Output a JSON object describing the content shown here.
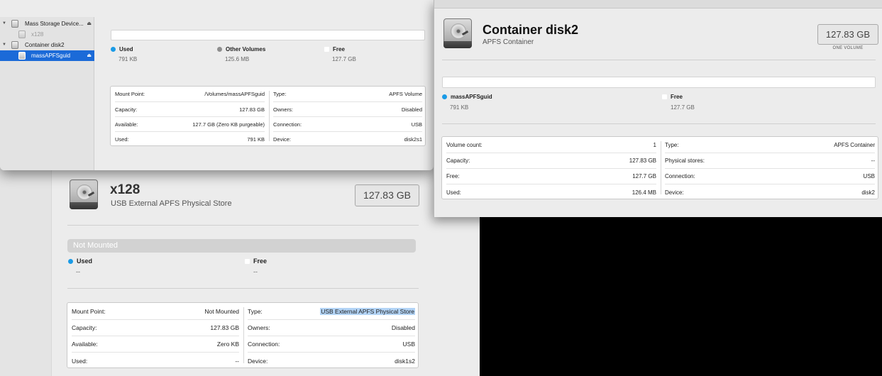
{
  "colors": {
    "used": "#1a9be6",
    "other": "#8e8e8e",
    "free": "#ffffff",
    "selection": "#1b6ad8"
  },
  "sidebar": {
    "items": [
      {
        "label": "Mass Storage Device...",
        "icon": "external-disk-icon",
        "eject": "⏏"
      },
      {
        "label": "x128",
        "icon": "disk-icon"
      },
      {
        "label": "Container disk2",
        "icon": "container-icon"
      },
      {
        "label": "massAPFSguid",
        "icon": "volume-icon",
        "eject": "⏏"
      }
    ]
  },
  "volume_window": {
    "legend": [
      {
        "label": "Used",
        "value": "791 KB"
      },
      {
        "label": "Other Volumes",
        "value": "125.6 MB"
      },
      {
        "label": "Free",
        "value": "127.7 GB"
      }
    ],
    "info_left": [
      {
        "key": "Mount Point:",
        "value": "/Volumes/massAPFSguid"
      },
      {
        "key": "Capacity:",
        "value": "127.83 GB"
      },
      {
        "key": "Available:",
        "value": "127.7 GB (Zero KB purgeable)"
      },
      {
        "key": "Used:",
        "value": "791 KB"
      }
    ],
    "info_right": [
      {
        "key": "Type:",
        "value": "APFS Volume"
      },
      {
        "key": "Owners:",
        "value": "Disabled"
      },
      {
        "key": "Connection:",
        "value": "USB"
      },
      {
        "key": "Device:",
        "value": "disk2s1"
      }
    ]
  },
  "physical_store_window": {
    "title": "x128",
    "subtitle": "USB External APFS Physical Store",
    "capacity": "127.83 GB",
    "status": "Not Mounted",
    "legend": [
      {
        "label": "Used",
        "value": "--"
      },
      {
        "label": "Free",
        "value": "--"
      }
    ],
    "info_left": [
      {
        "key": "Mount Point:",
        "value": "Not Mounted"
      },
      {
        "key": "Capacity:",
        "value": "127.83 GB"
      },
      {
        "key": "Available:",
        "value": "Zero KB"
      },
      {
        "key": "Used:",
        "value": "--"
      }
    ],
    "info_right": [
      {
        "key": "Type:",
        "value": "USB External APFS Physical Store"
      },
      {
        "key": "Owners:",
        "value": "Disabled"
      },
      {
        "key": "Connection:",
        "value": "USB"
      },
      {
        "key": "Device:",
        "value": "disk1s2"
      }
    ]
  },
  "container_window": {
    "title": "Container disk2",
    "subtitle": "APFS Container",
    "capacity": "127.83 GB",
    "capacity_note": "ONE VOLUME",
    "legend": [
      {
        "label": "massAPFSguid",
        "value": "791 KB"
      },
      {
        "label": "Free",
        "value": "127.7 GB"
      }
    ],
    "info_left": [
      {
        "key": "Volume count:",
        "value": "1"
      },
      {
        "key": "Capacity:",
        "value": "127.83 GB"
      },
      {
        "key": "Free:",
        "value": "127.7 GB"
      },
      {
        "key": "Used:",
        "value": "126.4 MB"
      }
    ],
    "info_right": [
      {
        "key": "Type:",
        "value": "APFS Container"
      },
      {
        "key": "Physical stores:",
        "value": "--"
      },
      {
        "key": "Connection:",
        "value": "USB"
      },
      {
        "key": "Device:",
        "value": "disk2"
      }
    ]
  }
}
